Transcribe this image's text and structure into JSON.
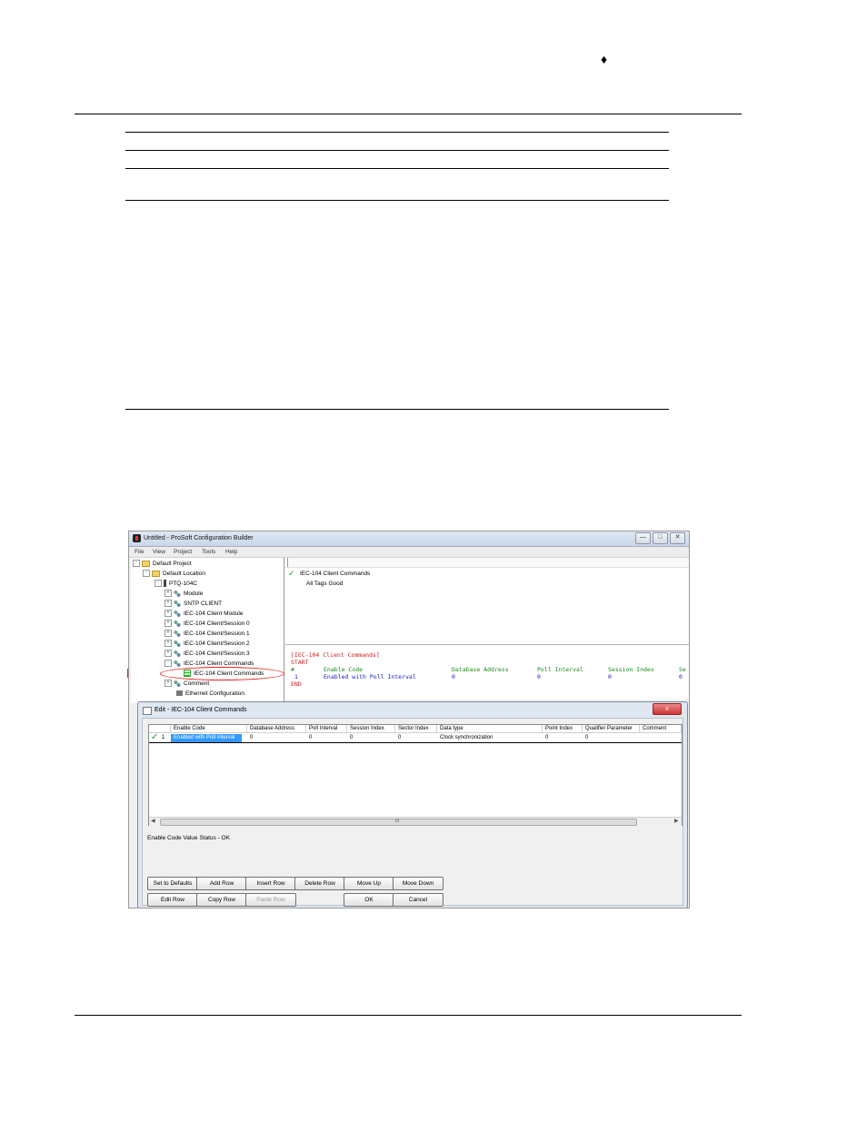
{
  "app": {
    "title": "Untitled - ProSoft Configuration Builder",
    "window_buttons": [
      "—",
      "□",
      "✕"
    ],
    "menu": [
      "File",
      "View",
      "Project",
      "Tools",
      "Help"
    ]
  },
  "tree": {
    "items": [
      {
        "label": "Default Project",
        "icon": "folder-icon",
        "expander": "-"
      },
      {
        "label": "Default Location",
        "icon": "folder-icon",
        "expander": "-"
      },
      {
        "label": "PTQ-104C",
        "icon": "module-icon",
        "expander": "-"
      },
      {
        "label": "Module",
        "icon": "network-icon",
        "expander": "+"
      },
      {
        "label": "SNTP CLIENT",
        "icon": "network-icon",
        "expander": "+"
      },
      {
        "label": "IEC-104 Client Module",
        "icon": "network-icon",
        "expander": "+"
      },
      {
        "label": "IEC-104 Client/Session 0",
        "icon": "network-icon",
        "expander": "+"
      },
      {
        "label": "IEC-104 Client/Session 1",
        "icon": "network-icon",
        "expander": "+"
      },
      {
        "label": "IEC-104 Client/Session 2",
        "icon": "network-icon",
        "expander": "+"
      },
      {
        "label": "IEC-104 Client/Session 3",
        "icon": "network-icon",
        "expander": "+"
      },
      {
        "label": "IEC-104 Client Commands",
        "icon": "network-icon",
        "expander": "-"
      },
      {
        "label": "IEC-104 Client Commands",
        "icon": "grid-icon",
        "expander": ""
      },
      {
        "label": "Comment",
        "icon": "network-icon",
        "expander": "+"
      },
      {
        "label": "Ethernet Configuration",
        "icon": "ethernet-icon",
        "expander": ""
      }
    ]
  },
  "status_pane": {
    "check_title": "IEC-104 Client Commands",
    "status_text": "All Tags Good"
  },
  "code_pane": {
    "section": "[IEC-104 Client Commands]",
    "start": "START",
    "header_hash": "#",
    "headers": [
      "Enable Code",
      "Database Address",
      "Poll Interval",
      "Session Index",
      "Se"
    ],
    "row_num": "1",
    "row_values": [
      "Enabled with Poll Interval",
      "0",
      "0",
      "0",
      "0"
    ],
    "end": "END"
  },
  "dialog": {
    "title": "Edit - IEC-104 Client Commands",
    "close": "x",
    "columns": [
      "Enable Code",
      "Database Address",
      "Poll Interval",
      "Session Index",
      "Sector Index",
      "Data type",
      "Point Index",
      "Qualifier Parameter",
      "Comment"
    ],
    "row": {
      "num": "1",
      "enable_code": "Enabled with Poll Interval",
      "database_address": "0",
      "poll_interval": "0",
      "session_index": "0",
      "sector_index": "0",
      "data_type": "Clock synchronization",
      "point_index": "0",
      "qualifier_parameter": "0",
      "comment": ""
    },
    "scroll_label": "III",
    "status": "Enable Code Value Status - OK",
    "buttons_row1": [
      "Set to Defaults",
      "Add Row",
      "Insert Row",
      "Delete Row",
      "Move Up",
      "Move Down"
    ],
    "buttons_row2": [
      "Edit Row",
      "Copy Row",
      "Paste Row",
      "OK",
      "Cancel"
    ]
  },
  "colors": {
    "highlight_red": "#e02020",
    "selection_blue": "#3399ff",
    "code_red": "#cc2222",
    "code_green": "#1a8a1a",
    "code_blue": "#1a1acc"
  }
}
